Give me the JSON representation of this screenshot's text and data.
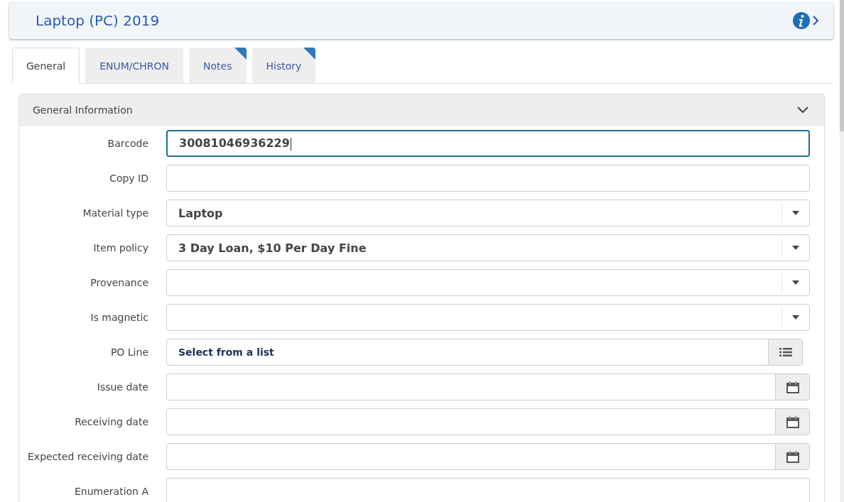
{
  "header": {
    "title": "Laptop (PC) 2019"
  },
  "tabs": [
    {
      "label": "General",
      "selected": true,
      "marked": false
    },
    {
      "label": "ENUM/CHRON",
      "selected": false,
      "marked": false
    },
    {
      "label": "Notes",
      "selected": false,
      "marked": true
    },
    {
      "label": "History",
      "selected": false,
      "marked": true
    }
  ],
  "section": {
    "title": "General Information",
    "expanded": true
  },
  "fields": [
    {
      "kind": "text",
      "label": "Barcode",
      "value": "30081046936229",
      "focused": true
    },
    {
      "kind": "text",
      "label": "Copy ID",
      "focused": false
    },
    {
      "kind": "select",
      "label": "Material type",
      "value": "Laptop",
      "focused": false
    },
    {
      "kind": "select",
      "label": "Item policy",
      "value": "3 Day Loan, $10 Per Day Fine",
      "focused": false
    },
    {
      "kind": "select",
      "label": "Provenance",
      "focused": false
    },
    {
      "kind": "select",
      "label": "Is magnetic",
      "focused": false
    },
    {
      "kind": "list",
      "label": "PO Line",
      "value": "Select from a list",
      "focused": false
    },
    {
      "kind": "date",
      "label": "Issue date",
      "focused": false
    },
    {
      "kind": "date",
      "label": "Receiving date",
      "focused": false
    },
    {
      "kind": "date",
      "label": "Expected receiving date",
      "focused": false
    },
    {
      "kind": "text",
      "label": "Enumeration A",
      "focused": false
    }
  ]
}
